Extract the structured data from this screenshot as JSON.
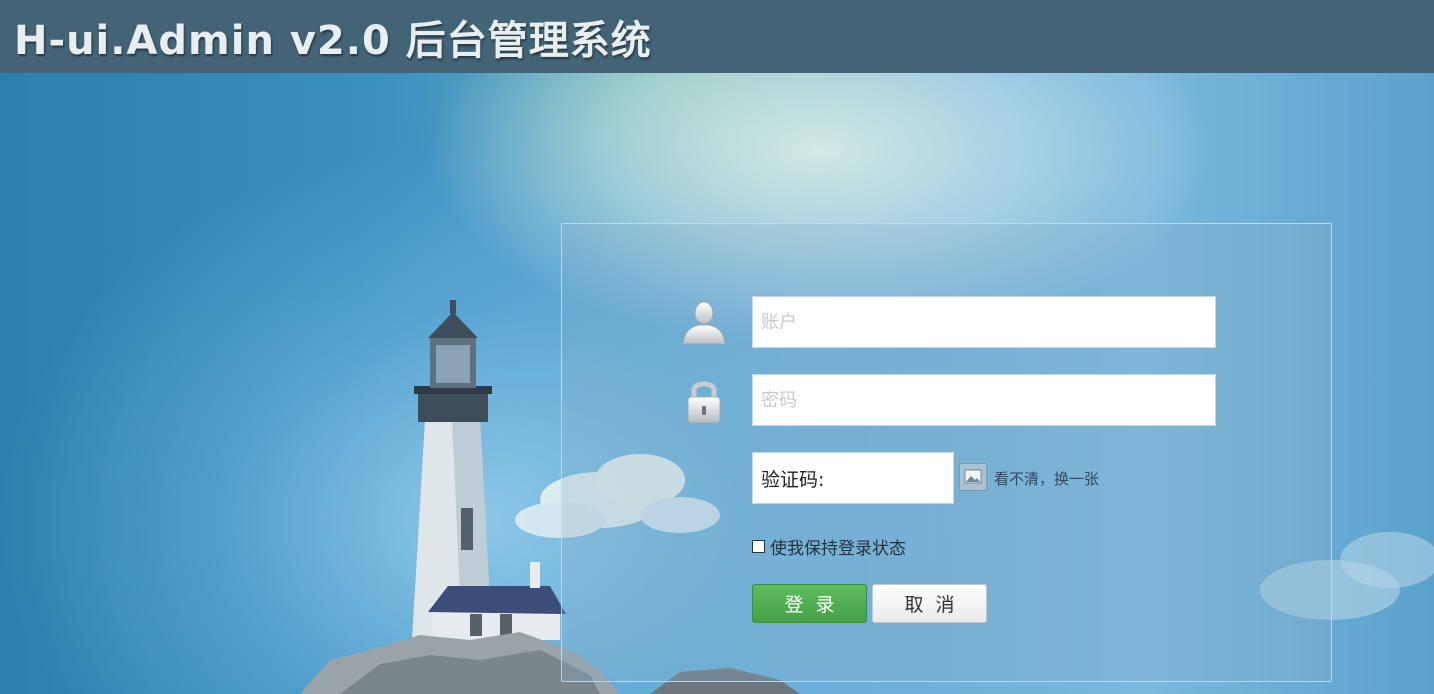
{
  "header": {
    "title": "H-ui.Admin v2.0 后台管理系统"
  },
  "login": {
    "account": {
      "placeholder": "账户",
      "icon": "user-icon"
    },
    "password": {
      "placeholder": "密码",
      "icon": "lock-icon"
    },
    "captcha": {
      "value": "验证码:",
      "refresh_label": "看不清，换一张",
      "image_icon": "captcha-image-icon"
    },
    "remember": {
      "label": "使我保持登录状态",
      "checked": false
    },
    "buttons": {
      "login_label": "登录",
      "cancel_label": "取消"
    }
  },
  "colors": {
    "header_bg": "#436476",
    "login_button": "#4fae4f",
    "background_blue": "#3a8ec0"
  }
}
